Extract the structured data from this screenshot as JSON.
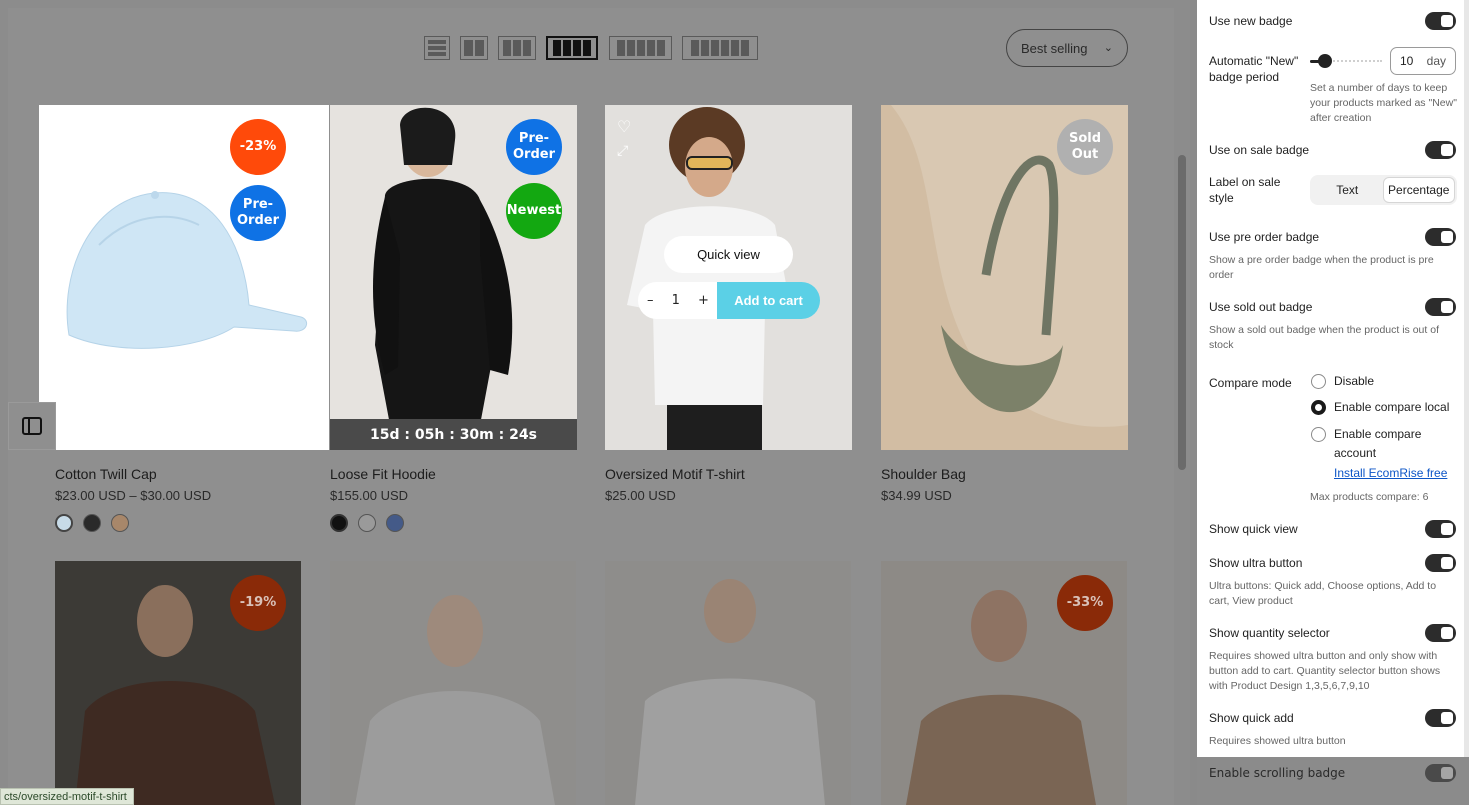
{
  "preview": {
    "layout_options": [
      "list",
      "2-columns",
      "3-columns",
      "4-columns",
      "5-columns",
      "6-columns"
    ],
    "active_layout": "4-columns",
    "sort_label": "Best selling",
    "products": [
      {
        "title": "Cotton Twill Cap",
        "price": "$23.00 USD – $30.00 USD",
        "badges": [
          "-23%",
          "Pre-\nOrder"
        ]
      },
      {
        "title": "Loose Fit Hoodie",
        "price": "$155.00 USD",
        "badges": [
          "Pre-\nOrder",
          "Newest"
        ],
        "countdown": "15d : 05h : 30m : 24s"
      },
      {
        "title": "Oversized Motif T-shirt",
        "price": "$25.00 USD",
        "quick_view": "Quick view",
        "qty": "1",
        "qty_minus": "–",
        "qty_plus": "+",
        "add_to_cart": "Add to cart"
      },
      {
        "title": "Shoulder Bag",
        "price": "$34.99 USD",
        "badges": [
          "Sold\nOut"
        ]
      }
    ],
    "row2_badges": [
      "-19%",
      "-33%"
    ],
    "status_url": "cts/oversized-motif-t-shirt"
  },
  "settings": {
    "new_badge_label": "Use new badge",
    "auto_new_label": "Automatic \"New\" badge period",
    "auto_new_value": "10",
    "auto_new_unit": "day",
    "auto_new_help": "Set a number of days to keep your products marked as \"New\" after creation",
    "on_sale_label": "Use on sale badge",
    "sale_style_label": "Label on sale style",
    "sale_style_options": [
      "Text",
      "Percentage"
    ],
    "pre_order_label": "Use pre order badge",
    "pre_order_help": "Show a pre order badge when the product is pre order",
    "sold_out_label": "Use sold out badge",
    "sold_out_help": "Show a sold out badge when the product is out of stock",
    "compare_label": "Compare mode",
    "compare_options": [
      "Disable",
      "Enable compare local",
      "Enable compare account"
    ],
    "compare_selected": "Enable compare local",
    "install_link": "Install EcomRise free",
    "max_compare": "Max products compare: 6",
    "quick_view_label": "Show quick view",
    "ultra_label": "Show ultra button",
    "ultra_help": "Ultra buttons: Quick add, Choose options, Add to cart, View product",
    "qty_selector_label": "Show quantity selector",
    "qty_selector_help": "Requires showed ultra button and only show with button add to cart. Quantity selector button shows with Product Design 1,3,5,6,7,9,10",
    "quick_add_label": "Show quick add",
    "quick_add_help": "Requires showed ultra button",
    "scrolling_badge_label": "Enable scrolling badge"
  }
}
